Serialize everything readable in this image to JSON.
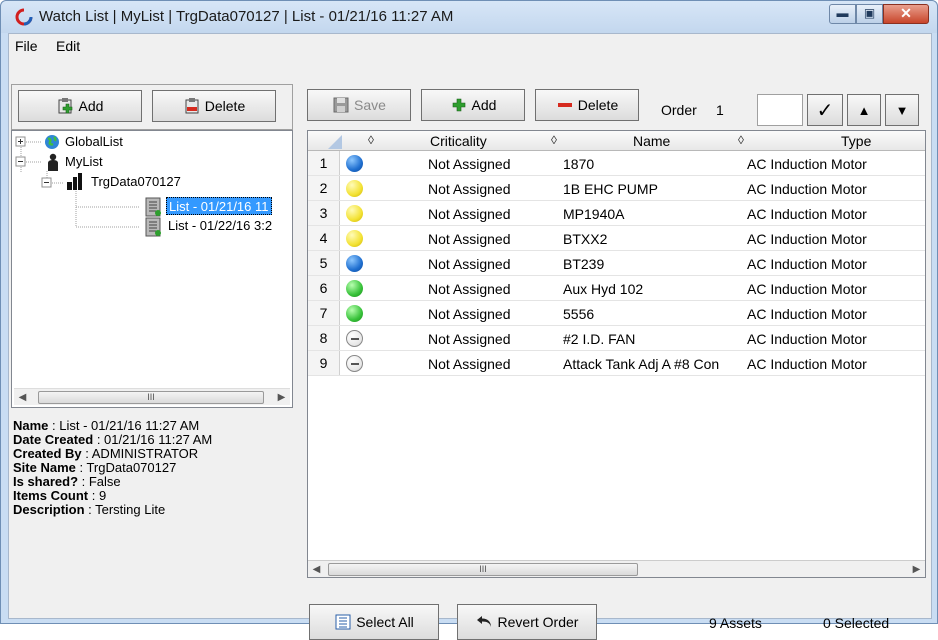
{
  "window": {
    "title": "Watch List | MyList | TrgData070127 | List - 01/21/16 11:27 AM",
    "close_glyph": "✕",
    "min_glyph": "▬",
    "max_glyph": "▣"
  },
  "menu": {
    "file": "File",
    "edit": "Edit"
  },
  "left_toolbar": {
    "add": "Add",
    "delete": "Delete"
  },
  "tree": {
    "nodes": [
      {
        "label": "GlobalList",
        "icon": "globe-icon"
      },
      {
        "label": "MyList",
        "icon": "user-icon"
      },
      {
        "label": "TrgData070127",
        "icon": "plant-icon"
      },
      {
        "label": "List - 01/21/16 11",
        "icon": "list-doc-icon",
        "selected": true
      },
      {
        "label": "List - 01/22/16 3:2",
        "icon": "list-doc-icon"
      }
    ],
    "scroll_thumb": "III"
  },
  "properties": {
    "name_label": "Name",
    "name_value": " : List - 01/21/16 11:27 AM",
    "date_label": "Date Created",
    "date_value": " : 01/21/16 11:27 AM",
    "created_by_label": "Created By",
    "created_by_value": " : ADMINISTRATOR",
    "site_label": "Site Name",
    "site_value": " : TrgData070127",
    "shared_label": "Is shared?",
    "shared_value": " : False",
    "count_label": "Items Count",
    "count_value": " : 9",
    "desc_label": "Description",
    "desc_value": " : Tersting Lite"
  },
  "right_toolbar": {
    "save": "Save",
    "add": "Add",
    "delete": "Delete",
    "order_label": "Order",
    "order_value": "1",
    "confirm_glyph": "✓",
    "up_glyph": "▲",
    "down_glyph": "▼"
  },
  "grid": {
    "columns": {
      "criticality": "Criticality",
      "name": "Name",
      "type": "Type"
    },
    "sort_glyph": "◊",
    "rows": [
      {
        "num": "1",
        "status": "blue",
        "criticality": "Not Assigned",
        "name": "1870",
        "type": "AC Induction Motor"
      },
      {
        "num": "2",
        "status": "yellow",
        "criticality": "Not Assigned",
        "name": "1B EHC PUMP",
        "type": "AC Induction Motor"
      },
      {
        "num": "3",
        "status": "yellow",
        "criticality": "Not Assigned",
        "name": "MP1940A",
        "type": "AC Induction Motor"
      },
      {
        "num": "4",
        "status": "yellow",
        "criticality": "Not Assigned",
        "name": "BTXX2",
        "type": "AC Induction Motor"
      },
      {
        "num": "5",
        "status": "blue",
        "criticality": "Not Assigned",
        "name": "BT239",
        "type": "AC Induction Motor"
      },
      {
        "num": "6",
        "status": "green",
        "criticality": "Not Assigned",
        "name": "Aux Hyd 102",
        "type": "AC Induction Motor"
      },
      {
        "num": "7",
        "status": "green",
        "criticality": "Not Assigned",
        "name": "5556",
        "type": "AC Induction Motor"
      },
      {
        "num": "8",
        "status": "none",
        "criticality": "Not Assigned",
        "name": "#2 I.D. FAN",
        "type": "AC Induction Motor"
      },
      {
        "num": "9",
        "status": "none",
        "criticality": "Not Assigned",
        "name": "Attack Tank Adj A #8 Con",
        "type": "AC Induction Motor"
      }
    ],
    "scroll_thumb": "III"
  },
  "bottom": {
    "select_all": "Select All",
    "revert_order": "Revert Order",
    "assets": "9 Assets",
    "selected": "0 Selected"
  },
  "colors": {
    "selection": "#3399ff",
    "status_blue": "#1f6fd0",
    "status_yellow": "#f3e234",
    "status_green": "#38c23a",
    "delete_red": "#d62a1e",
    "add_green": "#2e9e2e"
  }
}
